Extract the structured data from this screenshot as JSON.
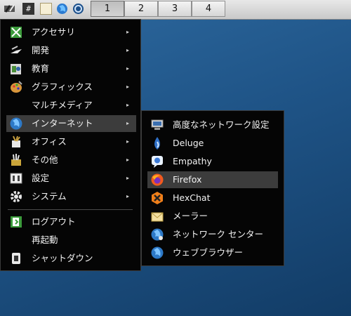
{
  "panel": {
    "launchers": [
      "tools-icon",
      "terminal-icon",
      "file-icon",
      "web-browser-icon",
      "system-logo-icon"
    ],
    "terminal_glyph": "#",
    "workspaces": [
      {
        "label": "1",
        "active": true
      },
      {
        "label": "2",
        "active": false
      },
      {
        "label": "3",
        "active": false
      },
      {
        "label": "4",
        "active": false
      }
    ]
  },
  "main_menu": {
    "items": [
      {
        "label": "アクセサリ",
        "icon": "accessories-icon",
        "submenu": true
      },
      {
        "label": "開発",
        "icon": "development-icon",
        "submenu": true
      },
      {
        "label": "教育",
        "icon": "education-icon",
        "submenu": true
      },
      {
        "label": "グラフィックス",
        "icon": "graphics-icon",
        "submenu": true
      },
      {
        "label": "マルチメディア",
        "icon": "",
        "submenu": true
      },
      {
        "label": "インターネット",
        "icon": "internet-icon",
        "submenu": true,
        "highlighted": true
      },
      {
        "label": "オフィス",
        "icon": "office-icon",
        "submenu": true
      },
      {
        "label": "その他",
        "icon": "other-icon",
        "submenu": true
      },
      {
        "label": "設定",
        "icon": "settings-icon",
        "submenu": true
      },
      {
        "label": "システム",
        "icon": "system-icon",
        "submenu": true
      }
    ],
    "actions": [
      {
        "label": "ログアウト",
        "icon": "logout-icon"
      },
      {
        "label": "再起動",
        "icon": ""
      },
      {
        "label": "シャットダウン",
        "icon": "shutdown-icon"
      }
    ],
    "arrow": "▸"
  },
  "internet_submenu": {
    "items": [
      {
        "label": "高度なネットワーク設定",
        "icon": "network-settings-icon"
      },
      {
        "label": "Deluge",
        "icon": "deluge-icon"
      },
      {
        "label": "Empathy",
        "icon": "empathy-icon"
      },
      {
        "label": "Firefox",
        "icon": "firefox-icon",
        "highlighted": true
      },
      {
        "label": "HexChat",
        "icon": "hexchat-icon"
      },
      {
        "label": "メーラー",
        "icon": "mail-icon"
      },
      {
        "label": "ネットワーク センター",
        "icon": "network-center-icon"
      },
      {
        "label": "ウェブブラウザー",
        "icon": "web-browser-icon"
      }
    ]
  }
}
